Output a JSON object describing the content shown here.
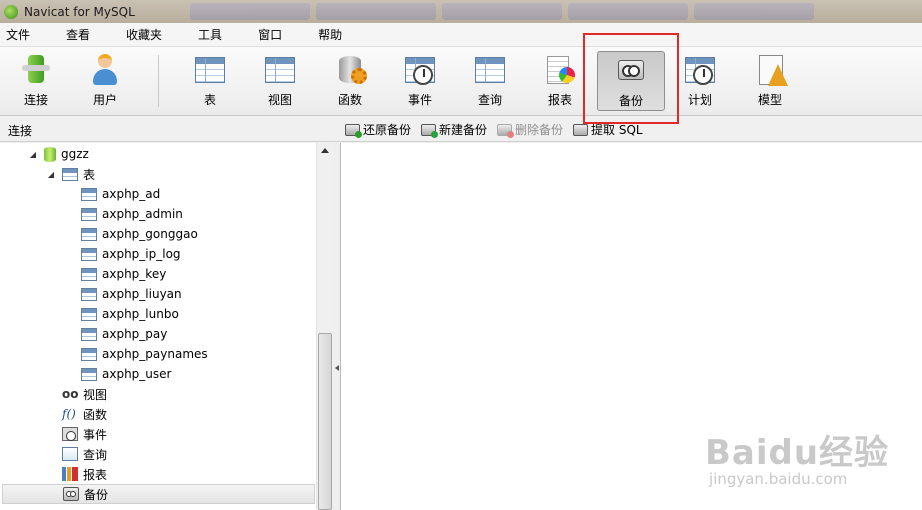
{
  "window": {
    "title": "Navicat for MySQL"
  },
  "menu": [
    "文件",
    "查看",
    "收藏夹",
    "工具",
    "窗口",
    "帮助"
  ],
  "toolbar": {
    "connect_label": "连接",
    "user_label": "用户",
    "table_label": "表",
    "view_label": "视图",
    "function_label": "函数",
    "event_label": "事件",
    "query_label": "查询",
    "report_label": "报表",
    "backup_label": "备份",
    "schedule_label": "计划",
    "model_label": "模型",
    "active": "备份"
  },
  "subbar": {
    "connection_label": "连接",
    "restore_label": "还原备份",
    "new_backup_label": "新建备份",
    "delete_backup_label": "删除备份",
    "extract_sql_label": "提取 SQL"
  },
  "tree": {
    "database": "ggzz",
    "tables_label": "表",
    "tables": [
      "axphp_ad",
      "axphp_admin",
      "axphp_gonggao",
      "axphp_ip_log",
      "axphp_key",
      "axphp_liuyan",
      "axphp_lunbo",
      "axphp_pay",
      "axphp_paynames",
      "axphp_user"
    ],
    "views_label": "视图",
    "functions_label": "函数",
    "events_label": "事件",
    "queries_label": "查询",
    "reports_label": "报表",
    "backups_label": "备份",
    "selected": "备份"
  },
  "watermark": {
    "brand": "Baidu经验",
    "sub": "jingyan.baidu.com"
  },
  "colors": {
    "highlight": "#e02a2a",
    "selected_row": "#e8e8e8"
  }
}
